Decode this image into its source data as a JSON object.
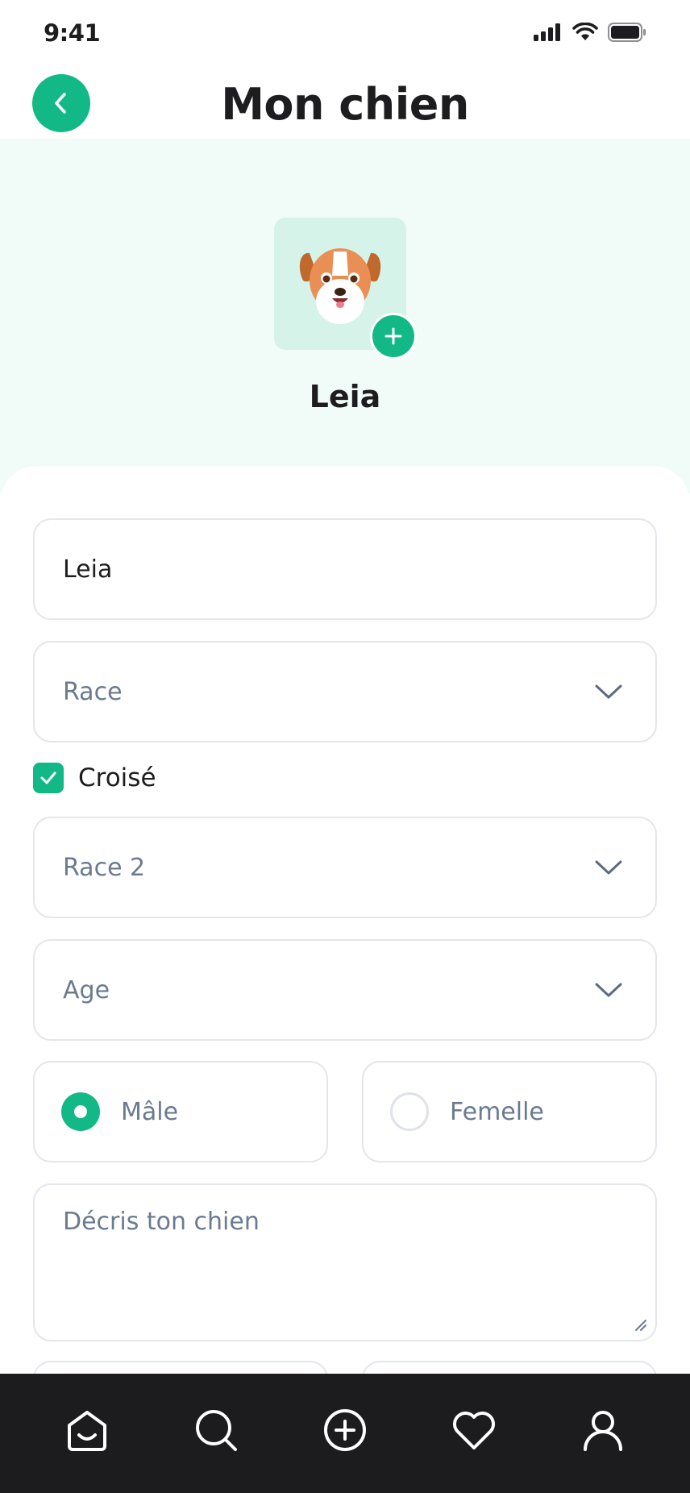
{
  "status_bar": {
    "time": "9:41"
  },
  "header": {
    "title": "Mon chien",
    "back_icon": "chevron-left-icon"
  },
  "profile": {
    "name": "Leia",
    "avatar": "dog-avatar-image",
    "add_photo_icon": "plus-icon"
  },
  "form": {
    "name_value": "Leia",
    "race_placeholder": "Race",
    "mixed_checkbox": {
      "label": "Croisé",
      "checked": true
    },
    "race2_placeholder": "Race 2",
    "age_placeholder": "Age",
    "sex": {
      "male_label": "Mâle",
      "female_label": "Femelle",
      "selected": "male"
    },
    "description_placeholder": "Décris ton chien"
  },
  "tab_bar": {
    "items": [
      "home-icon",
      "search-icon",
      "add-circle-icon",
      "heart-icon",
      "profile-icon"
    ]
  },
  "colors": {
    "accent": "#12b886",
    "hero_bg": "#f1fcf8",
    "tab_bar_bg": "#1c1c1e",
    "placeholder": "#6b7a90"
  }
}
